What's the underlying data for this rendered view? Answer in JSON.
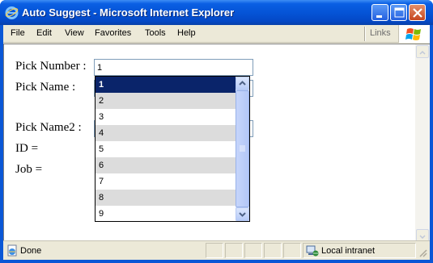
{
  "window": {
    "title": "Auto Suggest - Microsoft Internet Explorer"
  },
  "menu": {
    "items": [
      "File",
      "Edit",
      "View",
      "Favorites",
      "Tools",
      "Help"
    ],
    "links_label": "Links"
  },
  "form": {
    "pick_number_label": "Pick Number :",
    "pick_number_value": "1",
    "pick_name_label": "Pick Name :",
    "pick_name2_label": "Pick Name2 :",
    "id_label": "ID =",
    "job_label": "Job ="
  },
  "suggest": {
    "items": [
      "1",
      "2",
      "3",
      "4",
      "5",
      "6",
      "7",
      "8",
      "9"
    ],
    "selected_index": 0
  },
  "status": {
    "text": "Done",
    "zone": "Local intranet"
  },
  "colors": {
    "selection": "#0a246a",
    "alt_row": "#dcdcdc",
    "titlebar": "#0554d7"
  },
  "icons": {
    "app": "ie-logo-icon",
    "minimize": "minimize-icon",
    "maximize": "maximize-icon",
    "close": "close-icon",
    "windows_flag": "windows-flag-icon",
    "status_page": "page-icon",
    "zone": "intranet-zone-icon"
  }
}
